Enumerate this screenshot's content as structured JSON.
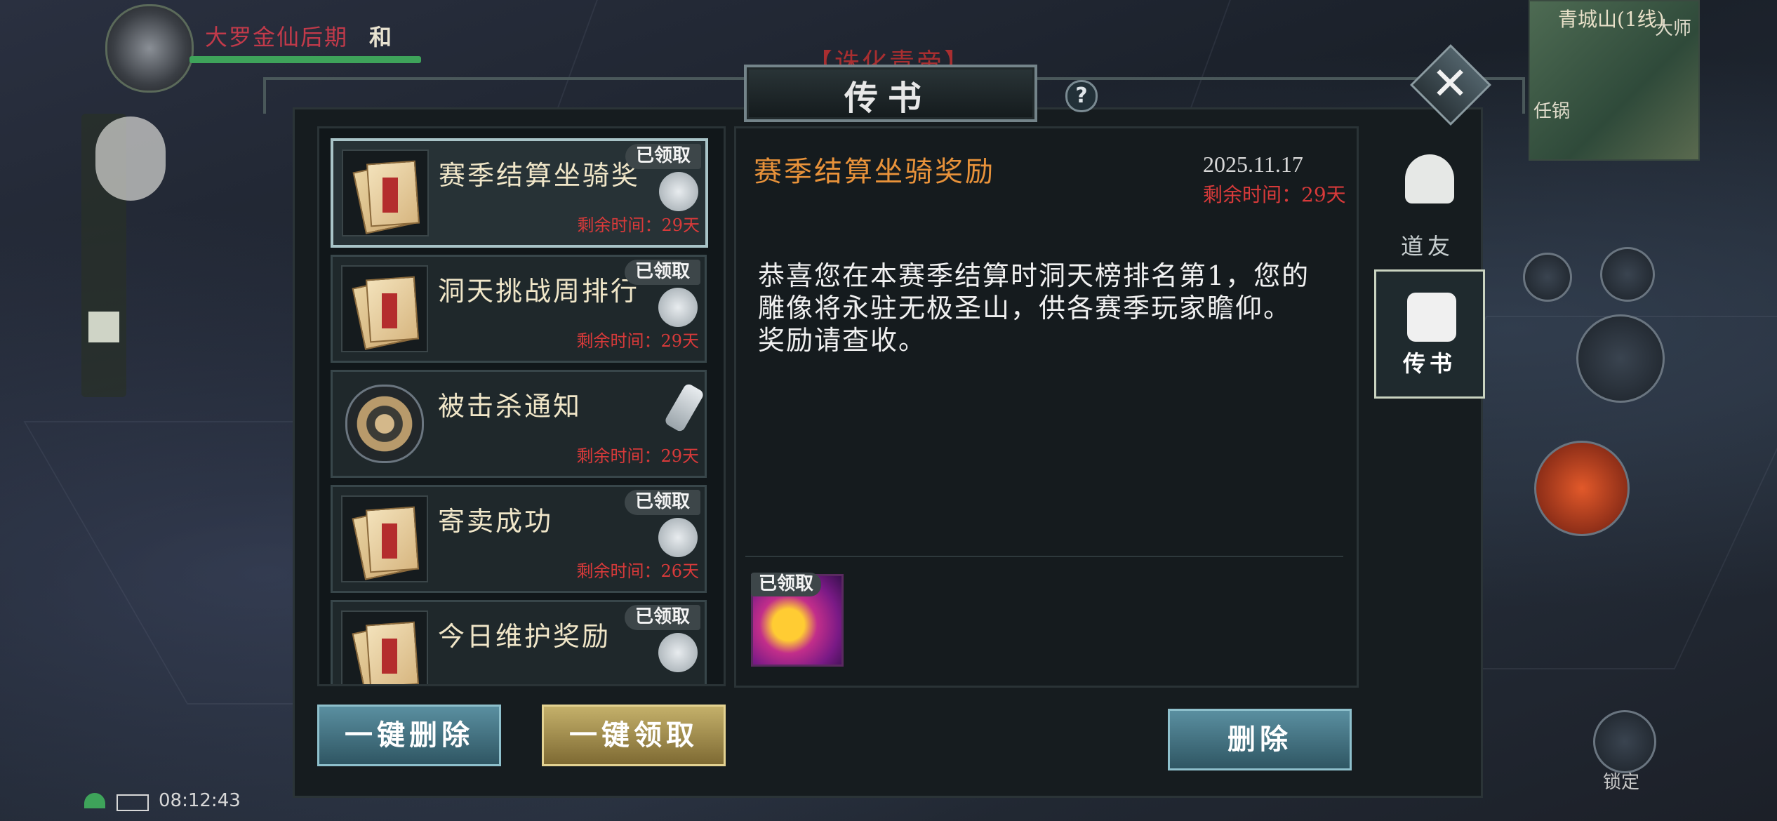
{
  "hud": {
    "realm": "大罗金仙后期",
    "server": "和",
    "event_banner": "【诛化青帝】",
    "minimap_name": "青城山(1线)",
    "minimap_npc_left": "任锅",
    "minimap_npc_right": "大师",
    "lock_label": "锁定",
    "clock": "08:12:43"
  },
  "dialog": {
    "title": "传书",
    "help": "?",
    "close": "✕"
  },
  "mails": [
    {
      "title": "赛季结算坐骑奖",
      "remain": "剩余时间：29天",
      "badge": "已领取",
      "icon": "scroll-icon",
      "selected": true
    },
    {
      "title": "洞天挑战周排行",
      "remain": "剩余时间：29天",
      "badge": "已领取",
      "icon": "scroll-icon"
    },
    {
      "title": "被击杀通知",
      "remain": "剩余时间：29天",
      "badge": "",
      "icon": "gear-icon"
    },
    {
      "title": "寄卖成功",
      "remain": "剩余时间：26天",
      "badge": "已领取",
      "icon": "scroll-icon"
    },
    {
      "title": "今日维护奖励",
      "remain": "",
      "badge": "已领取",
      "icon": "scroll-icon"
    }
  ],
  "detail": {
    "title": "赛季结算坐骑奖励",
    "date": "2025.11.17",
    "remain": "剩余时间：29天",
    "body_line1": "恭喜您在本赛季结算时洞天榜排名第1，您的",
    "body_line2": "雕像将永驻无极圣山，供各赛季玩家瞻仰。",
    "body_line3": "奖励请查收。",
    "reward_badge": "已领取"
  },
  "buttons": {
    "delete_all": "一键删除",
    "claim_all": "一键领取",
    "delete": "删除"
  },
  "tabs": {
    "friends": "道友",
    "mail": "传书"
  }
}
